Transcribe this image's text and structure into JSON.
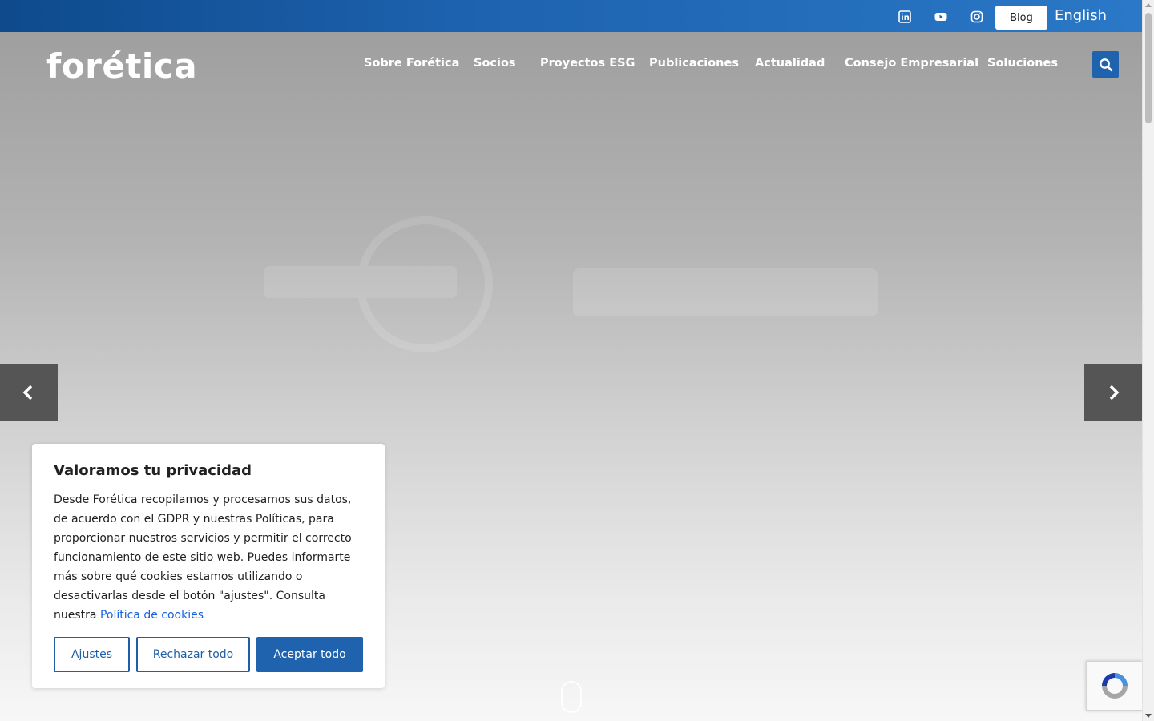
{
  "topbar": {
    "social": [
      {
        "name": "linkedin-icon"
      },
      {
        "name": "youtube-icon"
      },
      {
        "name": "instagram-icon"
      }
    ],
    "blog_label": "Blog",
    "language_label": "English"
  },
  "header": {
    "logo_text": "forética",
    "nav": [
      "Sobre Forética",
      "Socios",
      "Proyectos ESG",
      "Publicaciones",
      "Actualidad",
      "Consejo Empresarial",
      "Soluciones"
    ]
  },
  "cookie_banner": {
    "title": "Valoramos tu privacidad",
    "body": "Desde Forética recopilamos y procesamos sus datos, de acuerdo con el GDPR y nuestras Políticas, para proporcionar nuestros servicios y permitir el correcto funcionamiento de este sitio web. Puedes informarte más sobre qué cookies estamos utilizando o desactivarlas desde el botón \"ajustes\". Consulta nuestra",
    "link_text": "Política de cookies",
    "buttons": {
      "settings": "Ajustes",
      "reject": "Rechazar todo",
      "accept": "Aceptar todo"
    }
  },
  "colors": {
    "primary": "#1f63ae",
    "topbar_dark": "#0e4a8c",
    "link": "#1863dc"
  }
}
